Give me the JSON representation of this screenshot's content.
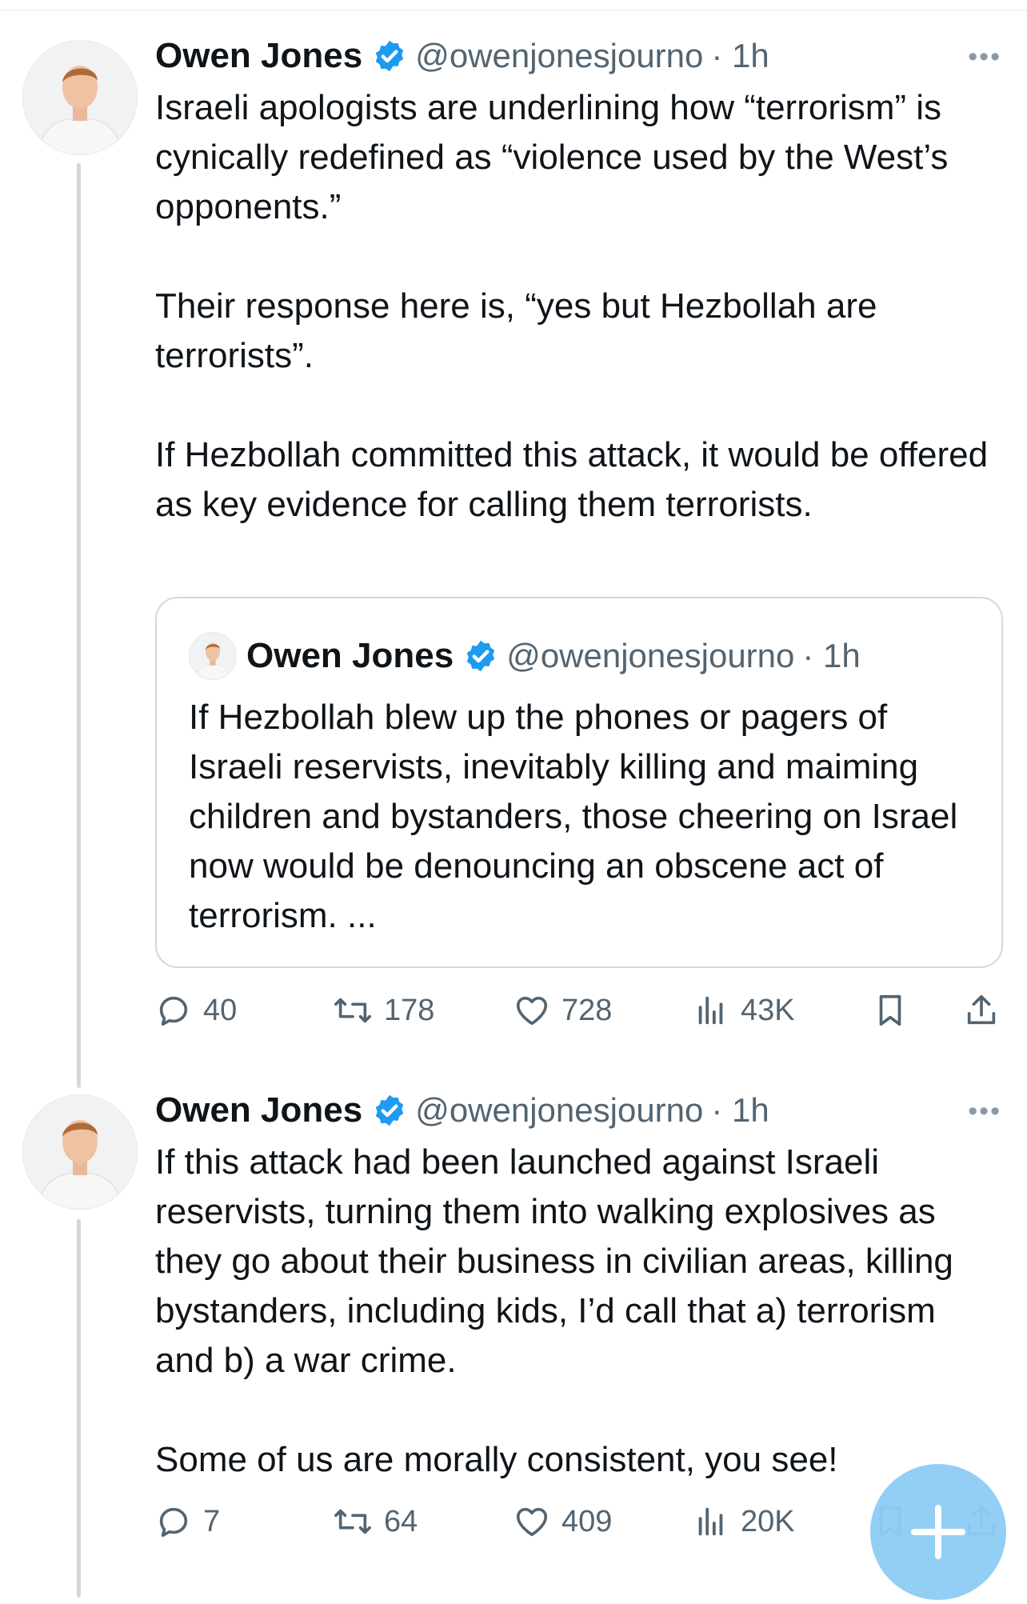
{
  "colors": {
    "verified": "#1d9bf0",
    "muted": "#536471",
    "thread_line": "#cfd9de",
    "fab": "#8ecdf5"
  },
  "tweets": [
    {
      "name": "Owen Jones",
      "handle": "@owenjonesjourno",
      "time": "· 1h",
      "more_icon": "more-horizontal-icon",
      "text": "Israeli apologists are underlining how “terrorism” is cynically redefined as “violence used by the West’s opponents.”\n\nTheir response here is, “yes but Hezbollah are terrorists”.\n\nIf Hezbollah committed this attack, it would be offered as key evidence for calling them terrorists.",
      "quote": {
        "name": "Owen Jones",
        "handle": "@owenjonesjourno",
        "time": "· 1h",
        "text": "If Hezbollah blew up the phones or pagers of Israeli reservists, inevitably killing and maiming children and bystanders, those cheering on Israel now would be denouncing an obscene act of terrorism. ..."
      },
      "stats": {
        "replies": "40",
        "reposts": "178",
        "likes": "728",
        "views": "43K"
      }
    },
    {
      "name": "Owen Jones",
      "handle": "@owenjonesjourno",
      "time": "· 1h",
      "more_icon": "more-horizontal-icon",
      "text": "If this attack had been launched against Israeli reservists, turning them into walking explosives as they go about their business in civilian areas, killing bystanders, including kids, I’d call that a) terrorism and b) a war crime.\n\nSome of us are morally consistent, you see!",
      "stats": {
        "replies": "7",
        "reposts": "64",
        "likes": "409",
        "views": "20K"
      }
    }
  ],
  "fab": {
    "icon": "compose-plus-icon"
  }
}
